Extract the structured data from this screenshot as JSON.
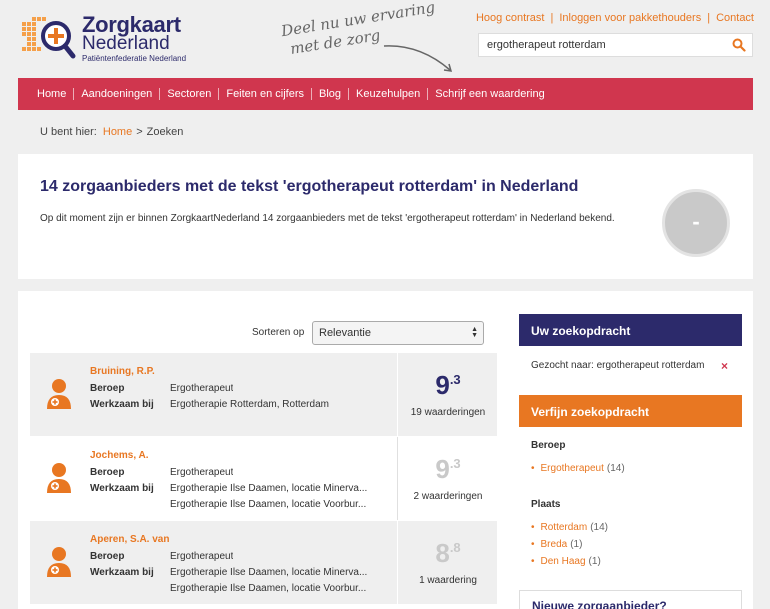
{
  "logo": {
    "title": "Zorgkaart",
    "subtitle": "Nederland",
    "tagline": "Patiëntenfederatie Nederland"
  },
  "slogan": {
    "line1": "Deel nu uw ervaring",
    "line2": "met de zorg"
  },
  "toplinks": [
    "Hoog contrast",
    "Inloggen voor pakkethouders",
    "Contact"
  ],
  "search": {
    "value": "ergotherapeut rotterdam",
    "icon": "search-icon"
  },
  "nav": [
    "Home",
    "Aandoeningen",
    "Sectoren",
    "Feiten en cijfers",
    "Blog",
    "Keuzehulpen",
    "Schrijf een waardering"
  ],
  "breadcrumb": {
    "prefix": "U bent hier:",
    "home": "Home",
    "sep": ">",
    "current": "Zoeken"
  },
  "intro": {
    "title": "14 zorgaanbieders met de tekst 'ergotherapeut rotterdam' in Nederland",
    "text": "Op dit moment zijn er binnen ZorgkaartNederland 14 zorgaanbieders met de tekst 'ergotherapeut rotterdam' in Nederland bekend.",
    "score": "-"
  },
  "sort": {
    "label": "Sorteren op",
    "selected": "Relevantie"
  },
  "results": [
    {
      "name": "Bruining, R.P.",
      "beroep_label": "Beroep",
      "beroep": "Ergotherapeut",
      "werkzaam_label": "Werkzaam bij",
      "werkzaam": [
        "Ergotherapie Rotterdam, Rotterdam"
      ],
      "score_int": "9",
      "score_dec": ".3",
      "score_color": "#2c2a6b",
      "reviews": "19 waarderingen"
    },
    {
      "name": "Jochems, A.",
      "beroep_label": "Beroep",
      "beroep": "Ergotherapeut",
      "werkzaam_label": "Werkzaam bij",
      "werkzaam": [
        "Ergotherapie Ilse Daamen, locatie Minerva...",
        "Ergotherapie Ilse Daamen, locatie Voorbur..."
      ],
      "score_int": "9",
      "score_dec": ".3",
      "score_color": "#c9c9c9",
      "reviews": "2 waarderingen"
    },
    {
      "name": "Aperen, S.A. van",
      "beroep_label": "Beroep",
      "beroep": "Ergotherapeut",
      "werkzaam_label": "Werkzaam bij",
      "werkzaam": [
        "Ergotherapie Ilse Daamen, locatie Minerva...",
        "Ergotherapie Ilse Daamen, locatie Voorbur..."
      ],
      "score_int": "8",
      "score_dec": ".8",
      "score_color": "#c9c9c9",
      "reviews": "1 waardering"
    }
  ],
  "sidebar": {
    "query_title": "Uw zoekopdracht",
    "searched": "Gezocht naar: ergotherapeut rotterdam",
    "remove": "×",
    "refine_title": "Verfijn zoekopdracht",
    "facets": [
      {
        "title": "Beroep",
        "items": [
          {
            "label": "Ergotherapeut",
            "count": "(14)"
          }
        ]
      },
      {
        "title": "Plaats",
        "items": [
          {
            "label": "Rotterdam",
            "count": "(14)"
          },
          {
            "label": "Breda",
            "count": "(1)"
          },
          {
            "label": "Den Haag",
            "count": "(1)"
          }
        ]
      }
    ],
    "new_provider": "Nieuwe zorgaanbieder?"
  },
  "colors": {
    "navy": "#2c2a6b",
    "red": "#d0364e",
    "orange": "#e87722"
  }
}
